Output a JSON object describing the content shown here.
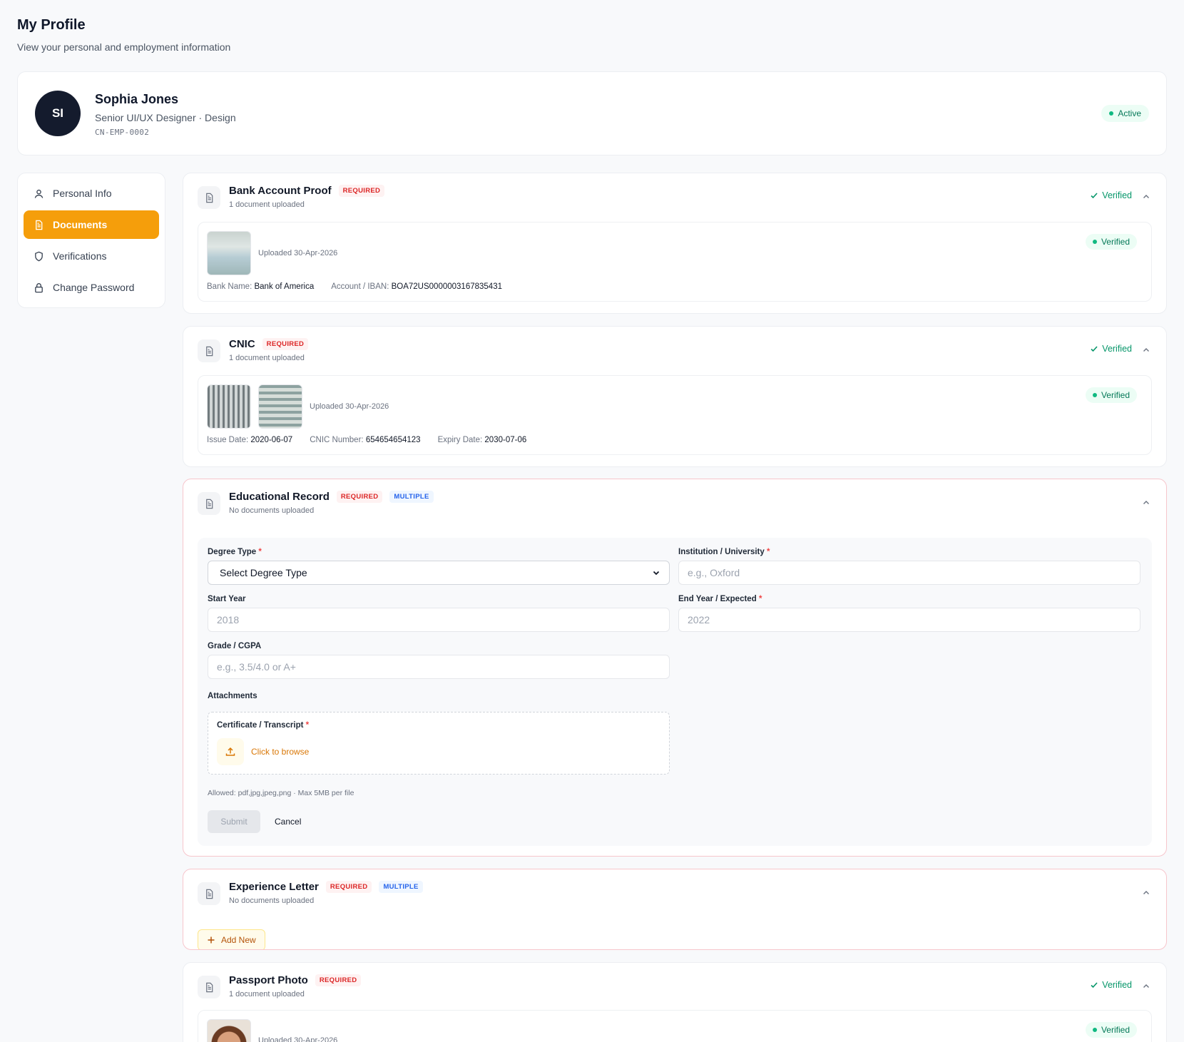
{
  "header": {
    "title": "My Profile",
    "subtitle": "View your personal and employment information"
  },
  "profile": {
    "initials": "SI",
    "name": "Sophia Jones",
    "role": "Senior UI/UX Designer · Design",
    "employee_id": "CN-EMP-0002",
    "status": "Active"
  },
  "sidebar": {
    "items": [
      {
        "label": "Personal Info",
        "icon": "user-icon"
      },
      {
        "label": "Documents",
        "icon": "document-icon",
        "active": true
      },
      {
        "label": "Verifications",
        "icon": "shield-icon"
      },
      {
        "label": "Change Password",
        "icon": "lock-icon"
      }
    ]
  },
  "documents": {
    "bank": {
      "title": "Bank Account Proof",
      "required": "REQUIRED",
      "count": "1 document uploaded",
      "status": "Verified",
      "file_status": "Verified",
      "uploaded": "Uploaded 30-Apr-2026",
      "bank_name_label": "Bank Name:",
      "bank_name": "Bank of America",
      "account_label": "Account / IBAN:",
      "account": "BOA72US0000003167835431"
    },
    "cnic": {
      "title": "CNIC",
      "required": "REQUIRED",
      "count": "1 document uploaded",
      "status": "Verified",
      "file_status": "Verified",
      "uploaded": "Uploaded 30-Apr-2026",
      "issue_label": "Issue Date:",
      "issue_date": "2020-06-07",
      "number_label": "CNIC Number:",
      "number": "654654654123",
      "expiry_label": "Expiry Date:",
      "expiry_date": "2030-07-06"
    },
    "education": {
      "title": "Educational Record",
      "required": "REQUIRED",
      "multiple": "MULTIPLE",
      "count": "No documents uploaded",
      "form": {
        "degree_label": "Degree Type",
        "degree_value": "Select Degree Type",
        "institution_label": "Institution / University",
        "institution_placeholder": "e.g., Oxford",
        "start_label": "Start Year",
        "start_placeholder": "2018",
        "end_label": "End Year / Expected",
        "end_placeholder": "2022",
        "grade_label": "Grade / CGPA",
        "grade_placeholder": "e.g., 3.5/4.0 or A+",
        "attachments_label": "Attachments",
        "certificate_label": "Certificate / Transcript",
        "browse": "Click to browse",
        "allowed": "Allowed: pdf,jpg,jpeg,png · Max 5MB per file",
        "submit": "Submit",
        "cancel": "Cancel",
        "required_mark": "*"
      }
    },
    "experience": {
      "title": "Experience Letter",
      "required": "REQUIRED",
      "multiple": "MULTIPLE",
      "count": "No documents uploaded",
      "add_new": "Add New"
    },
    "passport": {
      "title": "Passport Photo",
      "required": "REQUIRED",
      "count": "1 document uploaded",
      "status": "Verified",
      "file_status": "Verified",
      "uploaded": "Uploaded 30-Apr-2026"
    }
  },
  "colors": {
    "accent": "#f59e0b",
    "verified": "#059669",
    "required": "#dc2626",
    "multiple": "#2563eb",
    "avatar_bg": "#141b2d"
  }
}
